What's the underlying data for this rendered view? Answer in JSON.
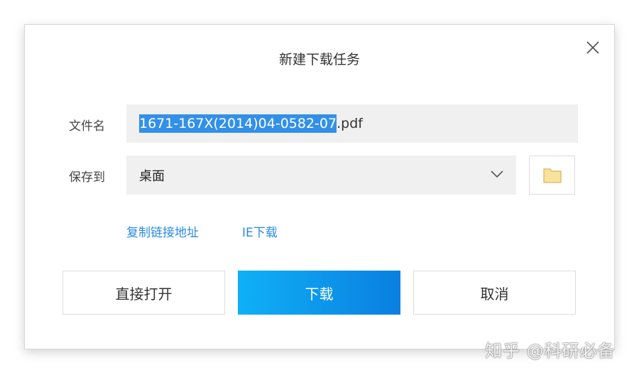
{
  "dialog": {
    "title": "新建下载任务",
    "close_icon": "close-icon"
  },
  "filename": {
    "label": "文件名",
    "value_selected": "1671-167X(2014)04-0582-07",
    "value_ext": ".pdf"
  },
  "save_to": {
    "label": "保存到",
    "value": "桌面",
    "folder_icon": "folder-icon",
    "folder_color": "#f9e39a"
  },
  "links": {
    "copy_link": "复制链接地址",
    "ie_download": "IE下载"
  },
  "buttons": {
    "open_direct": "直接打开",
    "download": "下载",
    "cancel": "取消"
  },
  "colors": {
    "primary_start": "#0fb0f7",
    "primary_end": "#0a7fe0",
    "link": "#2b8ae6",
    "selection": "#3390e8"
  },
  "watermark": "知乎 @科研必备"
}
